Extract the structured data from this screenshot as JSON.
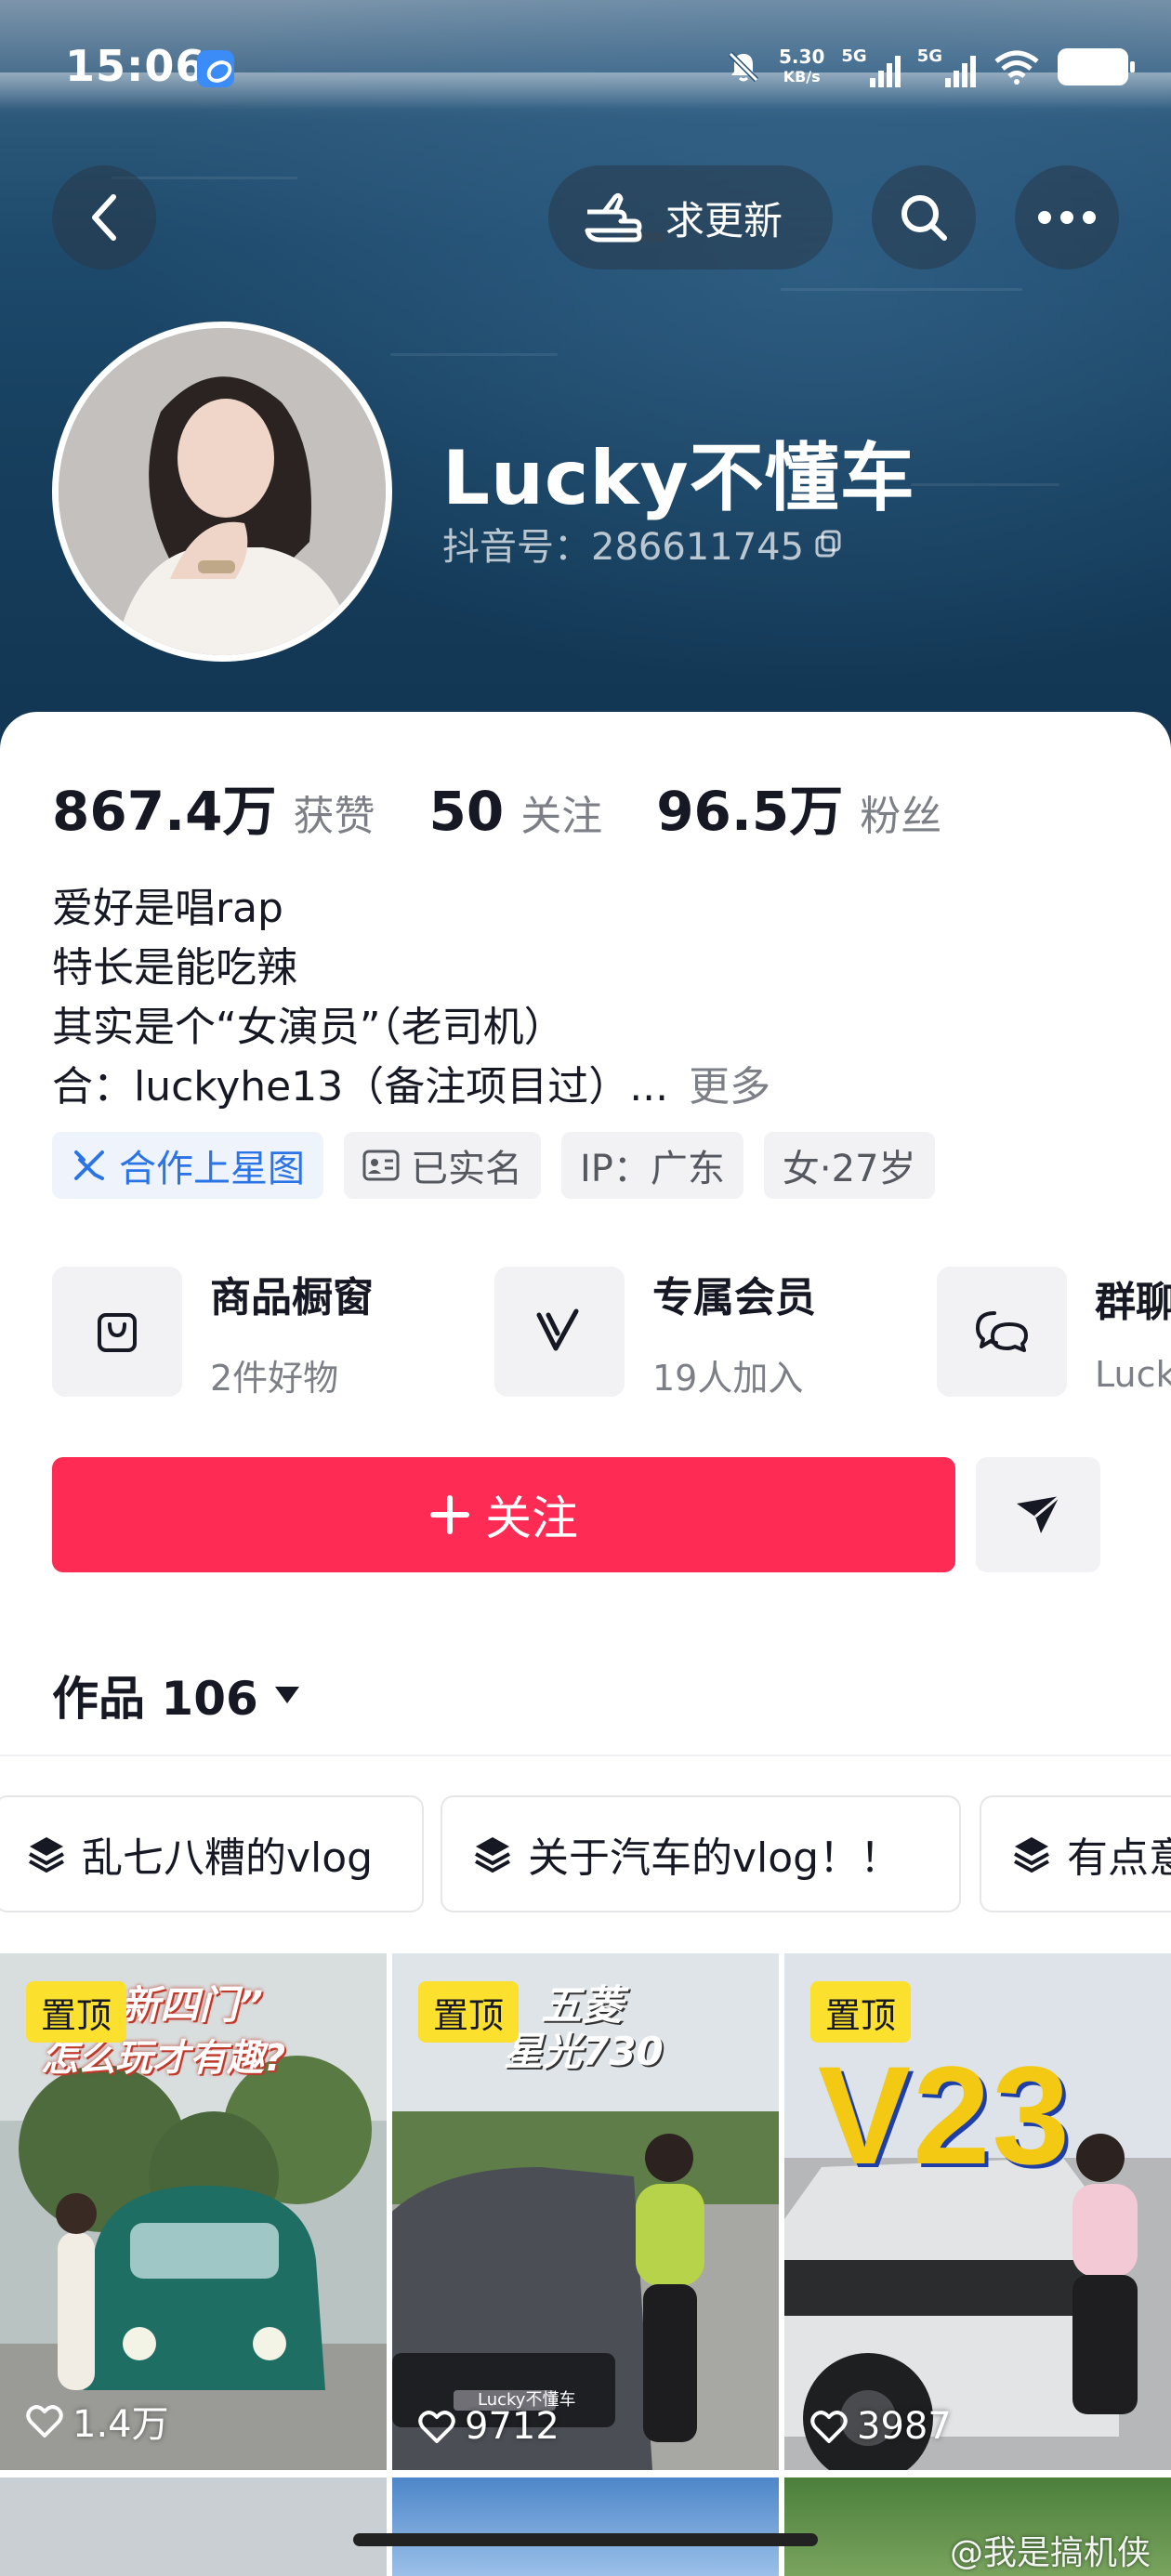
{
  "status_bar": {
    "time": "15:06",
    "net_speed_value": "5.30",
    "net_speed_unit": "KB/s",
    "sig1": "5G",
    "sig2": "5G",
    "battery": "100"
  },
  "top_actions": {
    "request_update_label": "求更新"
  },
  "profile": {
    "name": "Lucky不懂车",
    "douyin_id": "抖音号：286611745"
  },
  "stats": [
    {
      "value": "867.4万",
      "label": "获赞"
    },
    {
      "value": "50",
      "label": "关注"
    },
    {
      "value": "96.5万",
      "label": "粉丝"
    }
  ],
  "bio": {
    "lines": [
      "爱好是唱rap",
      "特长是能吃辣",
      "其实是个“女演员”（老司机）",
      "合：luckyhe13（备注项目过）..."
    ],
    "more": "更多"
  },
  "tags": [
    "合作上星图",
    "已实名",
    "IP：广东",
    "女·27岁"
  ],
  "shortcuts": [
    {
      "title": "商品橱窗",
      "sub": "2件好物"
    },
    {
      "title": "专属会员",
      "sub": "19人加入"
    },
    {
      "title": "群聊",
      "sub": "Lucky"
    }
  ],
  "follow": {
    "label": "关注"
  },
  "works": {
    "label": "作品 106"
  },
  "collections": [
    "乱七八糟的vlog",
    "关于汽车的vlog！！",
    "有点意思"
  ],
  "videos": [
    {
      "pin": "置顶",
      "likes": "1.4万",
      "title_l1": "新四门”",
      "title_l2": "怎么玩才有趣?"
    },
    {
      "pin": "置顶",
      "likes": "9712",
      "title_l1": "五菱",
      "title_l2": "星光730",
      "plate": "Lucky不懂车"
    },
    {
      "pin": "置顶",
      "likes": "3987",
      "big": "V23"
    }
  ],
  "watermark": "@我是搞机侠",
  "colors": {
    "accent": "#fe2c55",
    "pin": "#fbe02e",
    "tag_blue": "#2b74e6"
  }
}
